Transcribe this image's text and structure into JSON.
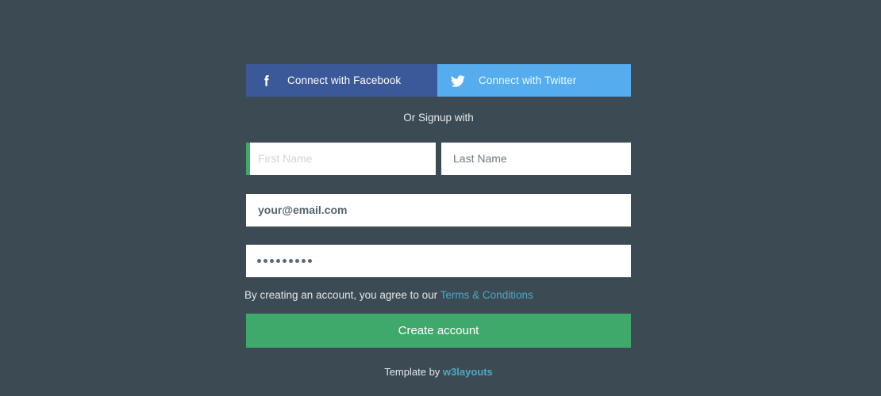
{
  "colors": {
    "background": "#3c4a53",
    "facebook_blue": "#3b5998",
    "twitter_blue": "#55acee",
    "accent_green": "#3fa96c",
    "link_teal": "#4fa8c7",
    "field_white": "#ffffff",
    "placeholder_gray": "#d2d4d6",
    "value_gray": "#6f7a80"
  },
  "social": {
    "facebook": {
      "label": "Connect with Facebook",
      "icon": "facebook-icon"
    },
    "twitter": {
      "label": "Connect with Twitter",
      "icon": "twitter-icon"
    }
  },
  "divider": {
    "label": "Or Signup with"
  },
  "form": {
    "first_name": {
      "placeholder": "First Name",
      "value": "",
      "focused": true
    },
    "last_name": {
      "placeholder": "Last Name",
      "value": "Last Name"
    },
    "email": {
      "placeholder": "your@email.com",
      "value": "your@email.com"
    },
    "password": {
      "value": "•••••••••",
      "masked_char_count": 9
    },
    "terms": {
      "text": "By creating an account, you agree to our",
      "link_label": "Terms & Conditions"
    },
    "submit": {
      "label": "Create account"
    }
  },
  "footer": {
    "text": "Template by",
    "link_label": "w3layouts"
  }
}
